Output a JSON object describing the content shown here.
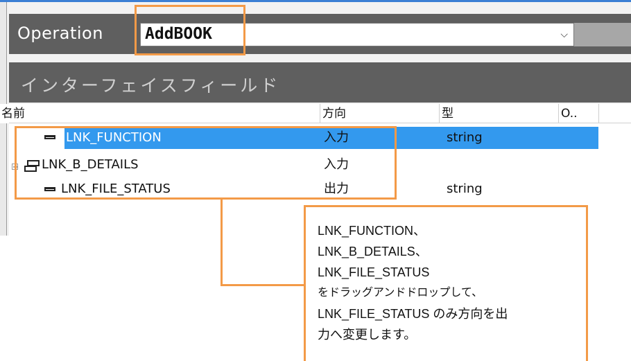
{
  "operation": {
    "label": "Operation",
    "selected": "AddBOOK"
  },
  "section": {
    "title": "インターフェイスフィールド"
  },
  "columns": [
    "名前",
    "方向",
    "型",
    "O.."
  ],
  "rows": [
    {
      "name": "LNK_FUNCTION",
      "direction": "入力",
      "type": "string",
      "icon": "field-icon",
      "selected": true
    },
    {
      "name": "LNK_B_DETAILS",
      "direction": "入力",
      "type": "",
      "icon": "group-icon",
      "expandable": true
    },
    {
      "name": "LNK_FILE_STATUS",
      "direction": "出力",
      "type": "string",
      "icon": "field-icon"
    }
  ],
  "callout": {
    "lines": [
      "LNK_FUNCTION、",
      "LNK_B_DETAILS、",
      "LNK_FILE_STATUS",
      "をドラッグアンドドロップして、",
      "LNK_FILE_STATUS のみ方向を出",
      "力へ変更します。"
    ]
  },
  "colors": {
    "highlight": "#f39a47",
    "selection": "#3399ee",
    "bar": "#5f5f5f"
  }
}
